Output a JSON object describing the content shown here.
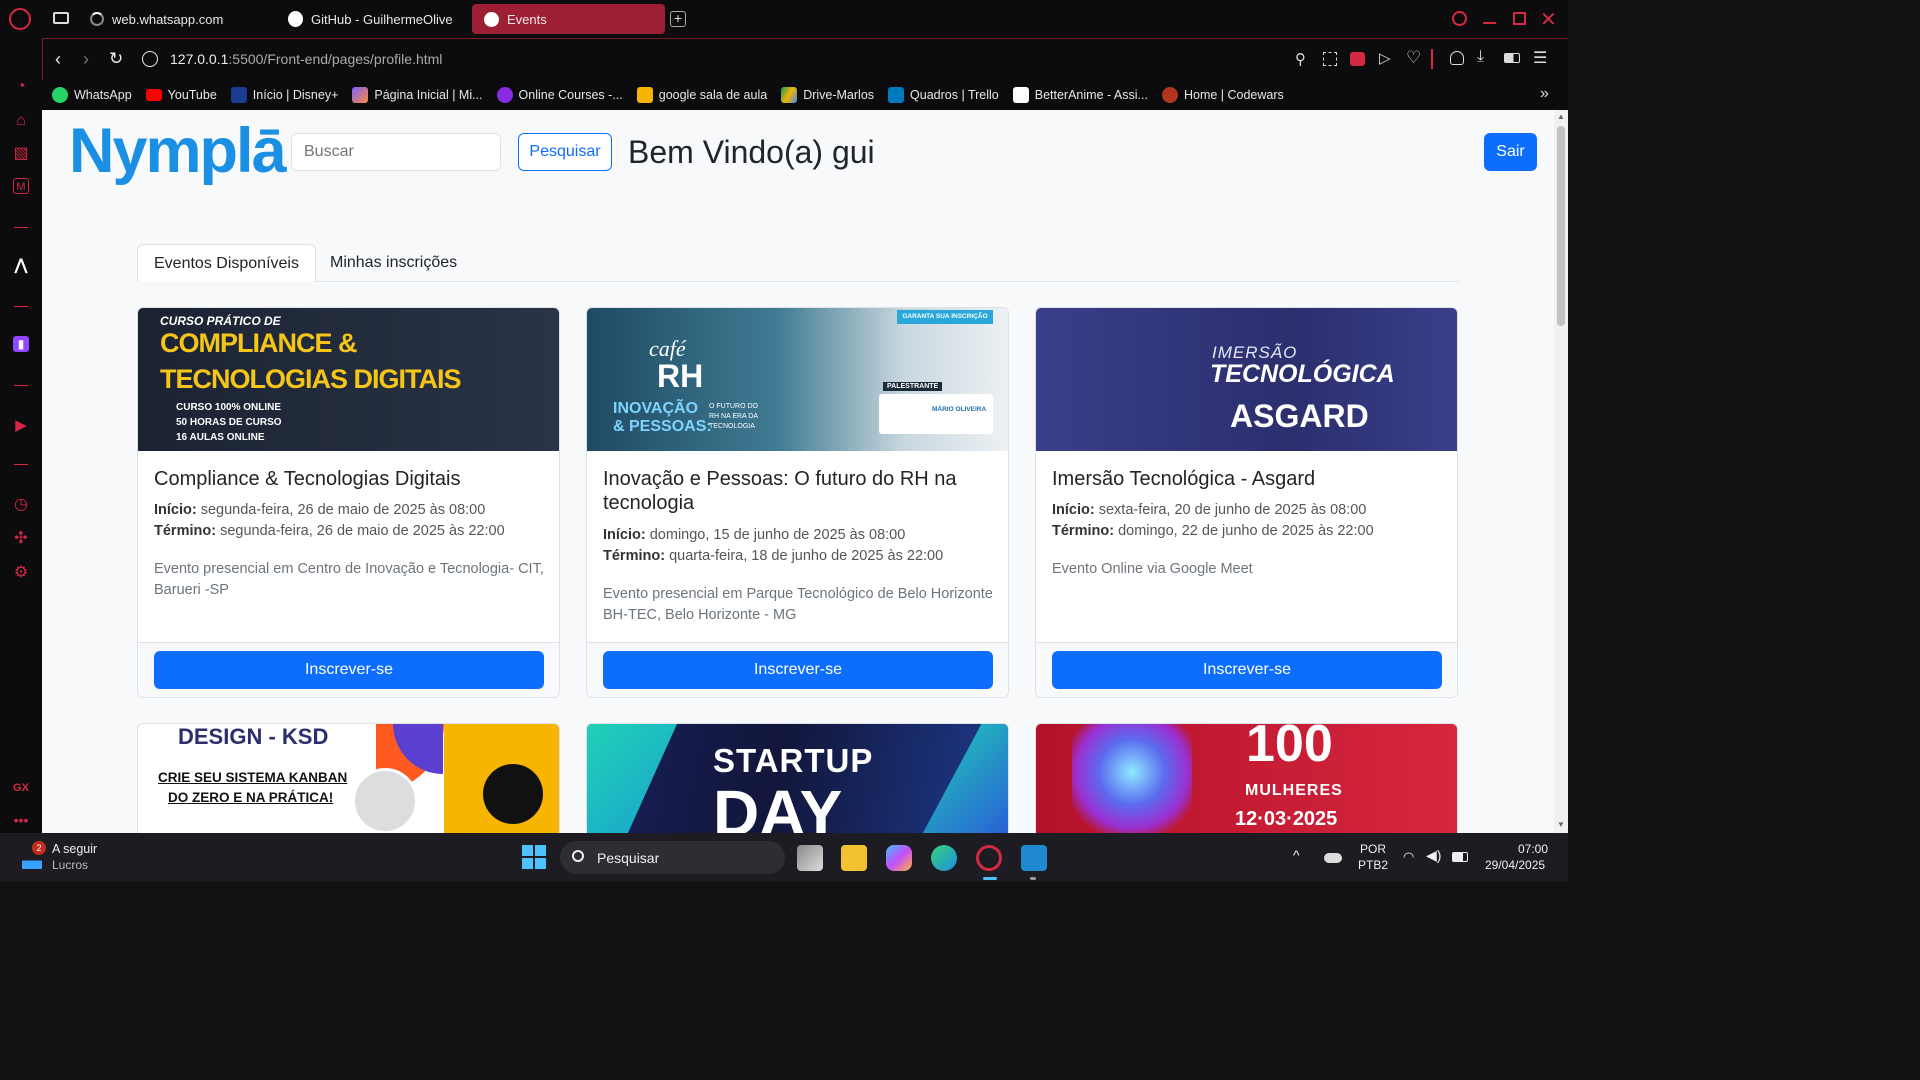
{
  "browser": {
    "tabs": [
      {
        "label": "web.whatsapp.com"
      },
      {
        "label": "GitHub - GuilhermeOliveir"
      },
      {
        "label": "Events"
      }
    ],
    "url_host": "127.0.0.1",
    "url_path": ":5500/Front-end/pages/profile.html",
    "bookmarks": [
      {
        "label": "WhatsApp",
        "color": "#25d366"
      },
      {
        "label": "YouTube",
        "color": "#ff0000"
      },
      {
        "label": "Início | Disney+",
        "color": "#1a3b8f"
      },
      {
        "label": "Página Inicial | Mi...",
        "color": "#7b61ff"
      },
      {
        "label": "Online Courses -...",
        "color": "#8a2be2"
      },
      {
        "label": "google sala de aula",
        "color": "#f4b400"
      },
      {
        "label": "Drive-Marlos",
        "color": "#0f9d58"
      },
      {
        "label": "Quadros | Trello",
        "color": "#0079bf"
      },
      {
        "label": "BetterAnime - Assi...",
        "color": "#ffffff"
      },
      {
        "label": "Home | Codewars",
        "color": "#b1361e"
      }
    ],
    "accent": "#d52842"
  },
  "header": {
    "logo": "Nymplā",
    "search_placeholder": "Buscar",
    "search_button": "Pesquisar",
    "welcome": "Bem Vindo(a) gui",
    "logout": "Sair"
  },
  "nav_tabs": [
    {
      "label": "Eventos Disponíveis",
      "active": true
    },
    {
      "label": "Minhas inscrições",
      "active": false
    }
  ],
  "labels": {
    "start": "Início:",
    "end": "Término:",
    "subscribe": "Inscrever-se"
  },
  "events": [
    {
      "title": "Compliance & Tecnologias Digitais",
      "start": "segunda-feira, 26 de maio de 2025 às 08:00",
      "end": "segunda-feira, 26 de maio de 2025 às 22:00",
      "description": "Evento presencial em Centro de Inovação e Tecnologia- CIT, Barueri -SP",
      "banner": [
        "CURSO PRÁTICO DE",
        "COMPLIANCE &",
        "TECNOLOGIAS DIGITAIS",
        "CURSO 100% ONLINE",
        "50 HORAS DE CURSO",
        "16 AULAS ONLINE"
      ]
    },
    {
      "title": "Inovação e Pessoas: O futuro do RH na tecnologia",
      "start": "domingo, 15 de junho de 2025 às 08:00",
      "end": "quarta-feira, 18 de junho de 2025 às 22:00",
      "description": "Evento presencial em Parque Tecnológico de Belo Horizonte BH-TEC, Belo Horizonte - MG",
      "banner": [
        "café",
        "RH",
        "INOVAÇÃO",
        "& PESSOAS:",
        "O FUTURO DO RH NA ERA DA TECNOLOGIA",
        "GARANTA SUA INSCRIÇÃO",
        "PALESTRANTE",
        "MÁRIO OLIVEIRA"
      ]
    },
    {
      "title": "Imersão Tecnológica - Asgard",
      "start": "sexta-feira, 20 de junho de 2025 às 08:00",
      "end": "domingo, 22 de junho de 2025 às 22:00",
      "description": "Evento Online via Google Meet",
      "banner": [
        "IMERSÃO",
        "TECNOLÓGICA",
        "ASGARD"
      ]
    }
  ],
  "more_events": [
    {
      "banner": [
        "DESIGN - KSD",
        "CRIE SEU SISTEMA KANBAN",
        "DO ZERO E NA PRÁTICA!"
      ]
    },
    {
      "banner": [
        "STARTUP",
        "DAY"
      ]
    },
    {
      "banner": [
        "100",
        "MULHERES",
        "12·03·2025"
      ]
    }
  ],
  "taskbar": {
    "widget_title": "A seguir",
    "widget_sub": "Lucros",
    "widget_badge": "2",
    "search": "Pesquisar",
    "lang": "POR",
    "layout": "PTB2",
    "time": "07:00",
    "date": "29/04/2025"
  }
}
